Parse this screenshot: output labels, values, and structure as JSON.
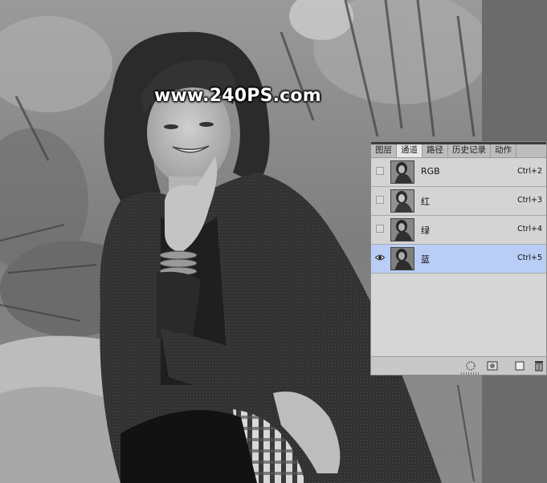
{
  "watermark": "www.240PS.com",
  "channels_panel": {
    "tabs": [
      {
        "label": "图层",
        "active": false
      },
      {
        "label": "通道",
        "active": true
      },
      {
        "label": "路径",
        "active": false
      },
      {
        "label": "历史记录",
        "active": false
      },
      {
        "label": "动作",
        "active": false
      }
    ],
    "channels": [
      {
        "name": "RGB",
        "shortcut": "Ctrl+2",
        "visible": false,
        "selected": false
      },
      {
        "name": "红",
        "shortcut": "Ctrl+3",
        "visible": false,
        "selected": false
      },
      {
        "name": "绿",
        "shortcut": "Ctrl+4",
        "visible": false,
        "selected": false
      },
      {
        "name": "蓝",
        "shortcut": "Ctrl+5",
        "visible": true,
        "selected": true
      }
    ],
    "footer_buttons": [
      "load-selection-icon",
      "save-selection-icon",
      "new-channel-icon",
      "delete-channel-icon"
    ]
  },
  "colors": {
    "panel_bg": "#d6d6d6",
    "selected_row": "#b9cdf5",
    "tab_bar": "#bdbdbd"
  }
}
